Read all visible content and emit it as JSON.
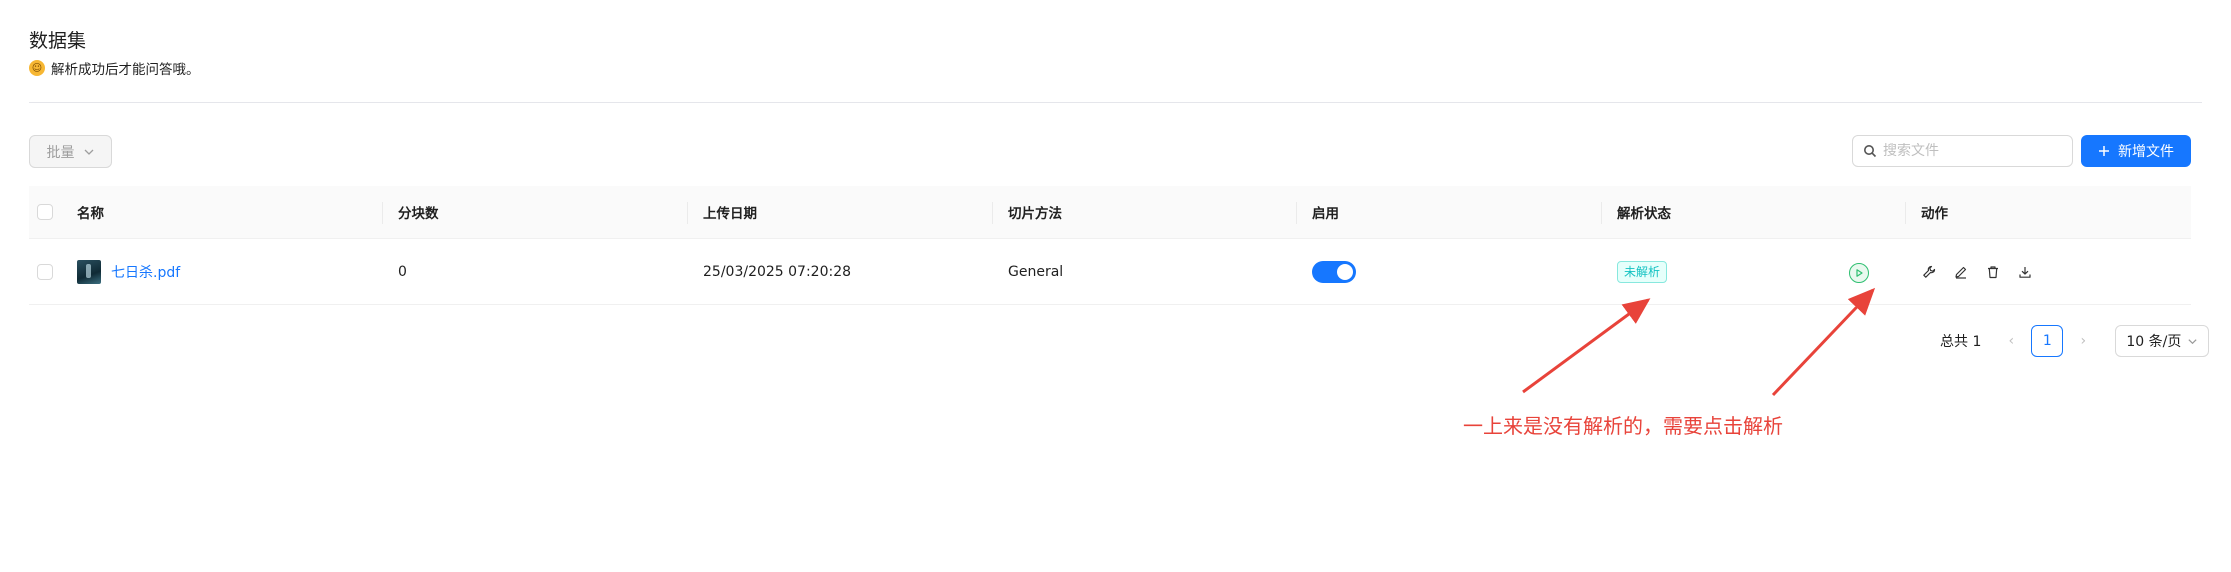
{
  "page": {
    "title": "数据集",
    "subtitle": "解析成功后才能问答哦。"
  },
  "toolbar": {
    "batch_label": "批量",
    "search_placeholder": "搜索文件",
    "new_file_label": "新增文件"
  },
  "table": {
    "headers": {
      "name": "名称",
      "chunks": "分块数",
      "upload_date": "上传日期",
      "chunk_method": "切片方法",
      "enabled": "启用",
      "parse_status": "解析状态",
      "actions": "动作"
    },
    "rows": [
      {
        "name": "七日杀.pdf",
        "chunks": "0",
        "upload_date": "25/03/2025 07:20:28",
        "chunk_method": "General",
        "enabled": true,
        "parse_status": "未解析"
      }
    ]
  },
  "pagination": {
    "total_label": "总共 1",
    "current_page": "1",
    "page_size": "10 条/页"
  },
  "annotation": {
    "text": "一上来是没有解析的，需要点击解析",
    "color": "#e8433a"
  },
  "colors": {
    "primary": "#1677ff",
    "status_badge": "#13c2c2",
    "play_green": "#2fbf71"
  },
  "icons": {
    "emoji": "smile-emoji-icon",
    "search": "search-icon",
    "add": "plus-icon",
    "play": "play-icon",
    "settings": "wrench-icon",
    "edit": "pencil-icon",
    "delete": "trash-icon",
    "download": "download-icon"
  }
}
